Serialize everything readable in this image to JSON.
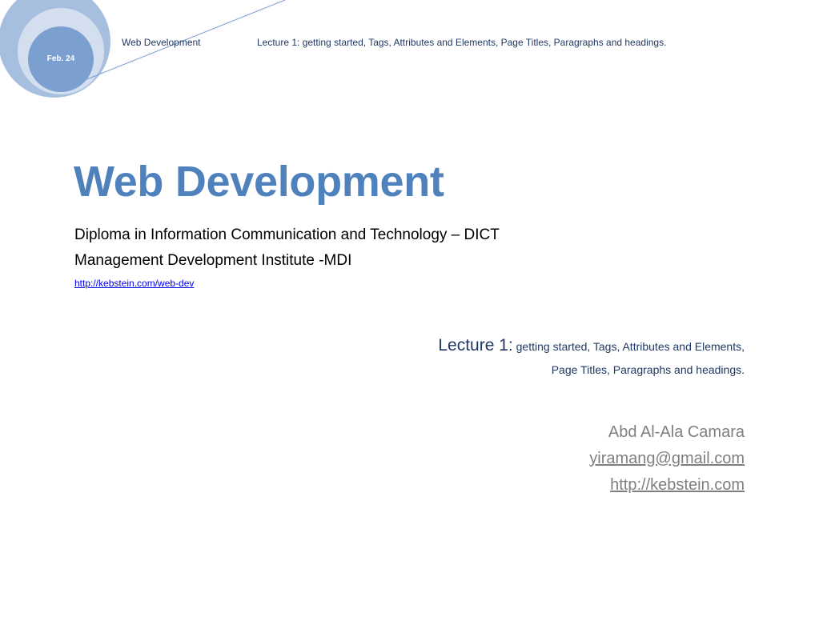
{
  "header": {
    "date": "Feb. 24",
    "left_title": "Web Development",
    "right_title": "Lecture 1: getting started, Tags, Attributes and Elements, Page Titles, Paragraphs and headings."
  },
  "title": "Web Development",
  "subtitle_lines": [
    "Diploma in Information Communication and Technology – DICT",
    "Management Development Institute -MDI"
  ],
  "course_link": "http://kebstein.com/web-dev",
  "lecture": {
    "prefix": "Lecture 1:",
    "line1_rest": " getting started, Tags, Attributes and Elements,",
    "line2": "Page Titles, Paragraphs and headings."
  },
  "author": {
    "name": "Abd Al-Ala Camara",
    "email": "yiramang@gmail.com",
    "website": "http://kebstein.com"
  },
  "colors": {
    "accent": "#4f81bd",
    "header_text": "#1f3864",
    "circle_outer": "#a7bfde",
    "circle_mid": "#d3dfee",
    "circle_inner": "#7b9fcf",
    "author_text": "#7f7f7f"
  }
}
